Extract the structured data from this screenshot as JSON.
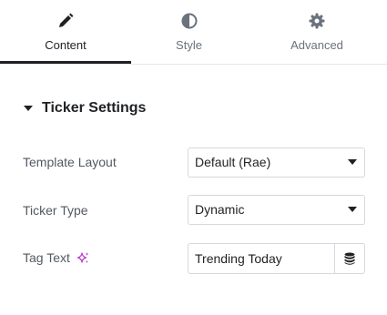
{
  "tabs": [
    {
      "label": "Content",
      "icon": "pencil-icon",
      "active": true
    },
    {
      "label": "Style",
      "icon": "half-circle-icon",
      "active": false
    },
    {
      "label": "Advanced",
      "icon": "gear-icon",
      "active": false
    }
  ],
  "section": {
    "title": "Ticker Settings",
    "expanded": true
  },
  "controls": {
    "template_layout": {
      "label": "Template Layout",
      "value": "Default (Rae)"
    },
    "ticker_type": {
      "label": "Ticker Type",
      "value": "Dynamic"
    },
    "tag_text": {
      "label": "Tag Text",
      "value": "Trending Today",
      "ai_icon": "sparkle-icon",
      "dynamic_icon": "database-icon"
    }
  },
  "colors": {
    "accent": "#c036ce",
    "text": "#1f2124",
    "muted": "#69727d",
    "border": "#d5d8dc"
  }
}
